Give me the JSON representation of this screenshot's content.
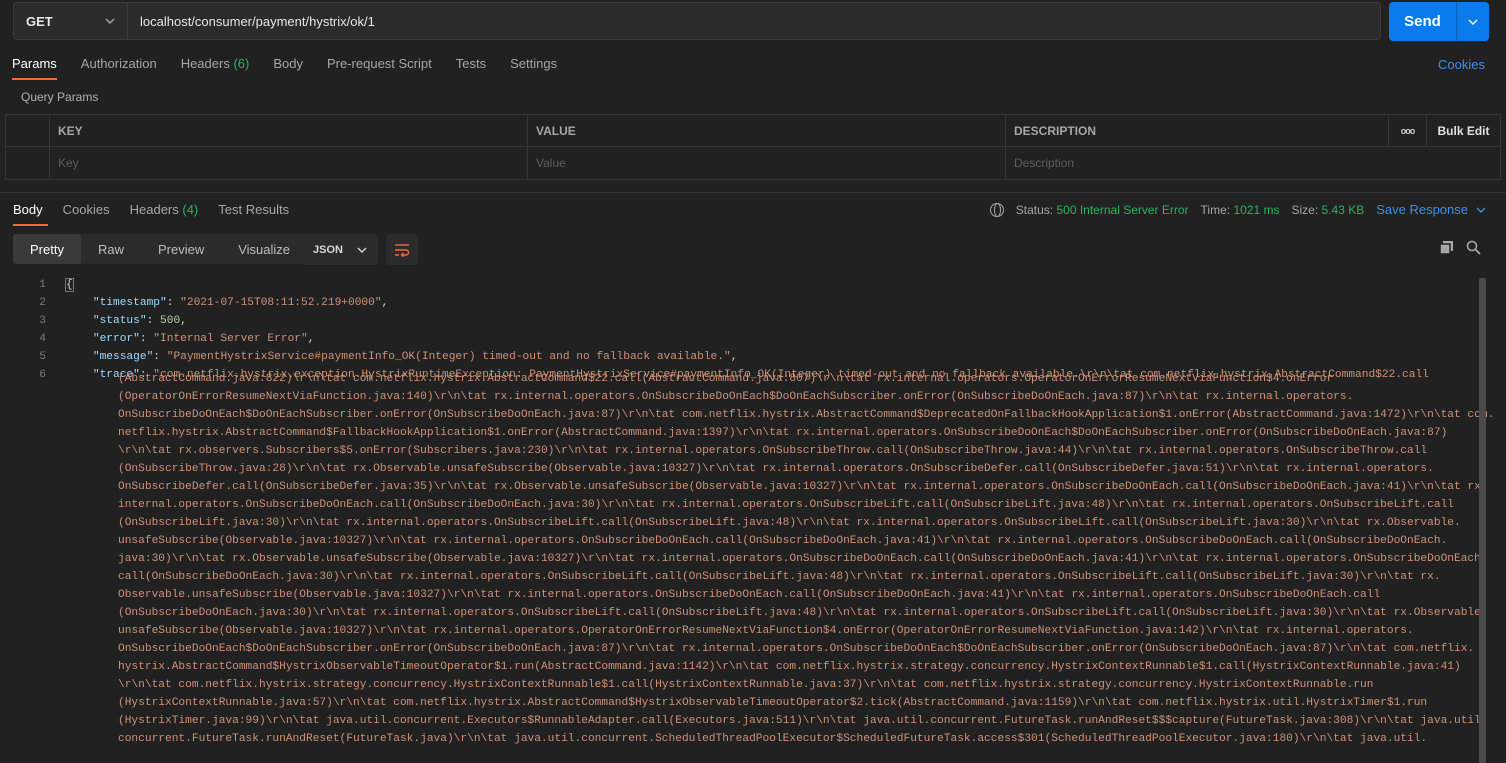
{
  "request": {
    "method": "GET",
    "url": "localhost/consumer/payment/hystrix/ok/1",
    "send_label": "Send"
  },
  "req_tabs": [
    {
      "label": "Params",
      "active": true
    },
    {
      "label": "Authorization"
    },
    {
      "label": "Headers",
      "count": "(6)"
    },
    {
      "label": "Body"
    },
    {
      "label": "Pre-request Script"
    },
    {
      "label": "Tests"
    },
    {
      "label": "Settings"
    }
  ],
  "cookies_label": "Cookies",
  "query_params_label": "Query Params",
  "params_table": {
    "headers": [
      "KEY",
      "VALUE",
      "DESCRIPTION"
    ],
    "more_label": "ooo",
    "bulk_edit_label": "Bulk Edit",
    "placeholders": [
      "Key",
      "Value",
      "Description"
    ]
  },
  "resp_tabs": [
    {
      "label": "Body",
      "active": true
    },
    {
      "label": "Cookies"
    },
    {
      "label": "Headers",
      "count": "(4)"
    },
    {
      "label": "Test Results"
    }
  ],
  "status": {
    "status_label": "Status:",
    "status_value": "500 Internal Server Error",
    "time_label": "Time:",
    "time_value": "1021 ms",
    "size_label": "Size:",
    "size_value": "5.43 KB",
    "save_label": "Save Response"
  },
  "view_modes": [
    {
      "label": "Pretty",
      "active": true
    },
    {
      "label": "Raw"
    },
    {
      "label": "Preview"
    },
    {
      "label": "Visualize"
    }
  ],
  "format": "JSON",
  "code": {
    "line_numbers": [
      "1",
      "2",
      "3",
      "4",
      "5",
      "6"
    ],
    "open_brace": "{",
    "timestamp_key": "\"timestamp\"",
    "timestamp_val": "\"2021-07-15T08:11:52.219+0000\"",
    "status_key": "\"status\"",
    "status_val": "500",
    "error_key": "\"error\"",
    "error_val": "\"Internal Server Error\"",
    "message_key": "\"message\"",
    "message_val": "\"PaymentHystrixService#paymentInfo_OK(Integer) timed-out and no fallback available.\"",
    "trace_key": "\"trace\"",
    "trace_first": "\"com.netflix.hystrix.exception.HystrixRuntimeException: PaymentHystrixService#paymentInfo_OK(Integer) timed-out and no fallback available.\\r\\n\\tat com.netflix.hystrix.AbstractCommand$22.call",
    "trace_lines": [
      "(AbstractCommand.java:822)\\r\\n\\tat com.netflix.hystrix.AbstractCommand$22.call(AbstractCommand.java:807)\\r\\n\\tat rx.internal.operators.OperatorOnErrorResumeNextViaFunction$4.onError",
      "(OperatorOnErrorResumeNextViaFunction.java:140)\\r\\n\\tat rx.internal.operators.OnSubscribeDoOnEach$DoOnEachSubscriber.onError(OnSubscribeDoOnEach.java:87)\\r\\n\\tat rx.internal.operators.",
      "OnSubscribeDoOnEach$DoOnEachSubscriber.onError(OnSubscribeDoOnEach.java:87)\\r\\n\\tat com.netflix.hystrix.AbstractCommand$DeprecatedOnFallbackHookApplication$1.onError(AbstractCommand.java:1472)\\r\\n\\tat com.",
      "netflix.hystrix.AbstractCommand$FallbackHookApplication$1.onError(AbstractCommand.java:1397)\\r\\n\\tat rx.internal.operators.OnSubscribeDoOnEach$DoOnEachSubscriber.onError(OnSubscribeDoOnEach.java:87)",
      "\\r\\n\\tat rx.observers.Subscribers$5.onError(Subscribers.java:230)\\r\\n\\tat rx.internal.operators.OnSubscribeThrow.call(OnSubscribeThrow.java:44)\\r\\n\\tat rx.internal.operators.OnSubscribeThrow.call",
      "(OnSubscribeThrow.java:28)\\r\\n\\tat rx.Observable.unsafeSubscribe(Observable.java:10327)\\r\\n\\tat rx.internal.operators.OnSubscribeDefer.call(OnSubscribeDefer.java:51)\\r\\n\\tat rx.internal.operators.",
      "OnSubscribeDefer.call(OnSubscribeDefer.java:35)\\r\\n\\tat rx.Observable.unsafeSubscribe(Observable.java:10327)\\r\\n\\tat rx.internal.operators.OnSubscribeDoOnEach.call(OnSubscribeDoOnEach.java:41)\\r\\n\\tat rx.",
      "internal.operators.OnSubscribeDoOnEach.call(OnSubscribeDoOnEach.java:30)\\r\\n\\tat rx.internal.operators.OnSubscribeLift.call(OnSubscribeLift.java:48)\\r\\n\\tat rx.internal.operators.OnSubscribeLift.call",
      "(OnSubscribeLift.java:30)\\r\\n\\tat rx.internal.operators.OnSubscribeLift.call(OnSubscribeLift.java:48)\\r\\n\\tat rx.internal.operators.OnSubscribeLift.call(OnSubscribeLift.java:30)\\r\\n\\tat rx.Observable.",
      "unsafeSubscribe(Observable.java:10327)\\r\\n\\tat rx.internal.operators.OnSubscribeDoOnEach.call(OnSubscribeDoOnEach.java:41)\\r\\n\\tat rx.internal.operators.OnSubscribeDoOnEach.call(OnSubscribeDoOnEach.",
      "java:30)\\r\\n\\tat rx.Observable.unsafeSubscribe(Observable.java:10327)\\r\\n\\tat rx.internal.operators.OnSubscribeDoOnEach.call(OnSubscribeDoOnEach.java:41)\\r\\n\\tat rx.internal.operators.OnSubscribeDoOnEach.",
      "call(OnSubscribeDoOnEach.java:30)\\r\\n\\tat rx.internal.operators.OnSubscribeLift.call(OnSubscribeLift.java:48)\\r\\n\\tat rx.internal.operators.OnSubscribeLift.call(OnSubscribeLift.java:30)\\r\\n\\tat rx.",
      "Observable.unsafeSubscribe(Observable.java:10327)\\r\\n\\tat rx.internal.operators.OnSubscribeDoOnEach.call(OnSubscribeDoOnEach.java:41)\\r\\n\\tat rx.internal.operators.OnSubscribeDoOnEach.call",
      "(OnSubscribeDoOnEach.java:30)\\r\\n\\tat rx.internal.operators.OnSubscribeLift.call(OnSubscribeLift.java:48)\\r\\n\\tat rx.internal.operators.OnSubscribeLift.call(OnSubscribeLift.java:30)\\r\\n\\tat rx.Observable.",
      "unsafeSubscribe(Observable.java:10327)\\r\\n\\tat rx.internal.operators.OperatorOnErrorResumeNextViaFunction$4.onError(OperatorOnErrorResumeNextViaFunction.java:142)\\r\\n\\tat rx.internal.operators.",
      "OnSubscribeDoOnEach$DoOnEachSubscriber.onError(OnSubscribeDoOnEach.java:87)\\r\\n\\tat rx.internal.operators.OnSubscribeDoOnEach$DoOnEachSubscriber.onError(OnSubscribeDoOnEach.java:87)\\r\\n\\tat com.netflix.",
      "hystrix.AbstractCommand$HystrixObservableTimeoutOperator$1.run(AbstractCommand.java:1142)\\r\\n\\tat com.netflix.hystrix.strategy.concurrency.HystrixContextRunnable$1.call(HystrixContextRunnable.java:41)",
      "\\r\\n\\tat com.netflix.hystrix.strategy.concurrency.HystrixContextRunnable$1.call(HystrixContextRunnable.java:37)\\r\\n\\tat com.netflix.hystrix.strategy.concurrency.HystrixContextRunnable.run",
      "(HystrixContextRunnable.java:57)\\r\\n\\tat com.netflix.hystrix.AbstractCommand$HystrixObservableTimeoutOperator$2.tick(AbstractCommand.java:1159)\\r\\n\\tat com.netflix.hystrix.util.HystrixTimer$1.run",
      "(HystrixTimer.java:99)\\r\\n\\tat java.util.concurrent.Executors$RunnableAdapter.call(Executors.java:511)\\r\\n\\tat java.util.concurrent.FutureTask.runAndReset$$$capture(FutureTask.java:308)\\r\\n\\tat java.util.",
      "concurrent.FutureTask.runAndReset(FutureTask.java)\\r\\n\\tat java.util.concurrent.ScheduledThreadPoolExecutor$ScheduledFutureTask.access$301(ScheduledThreadPoolExecutor.java:180)\\r\\n\\tat java.util."
    ]
  }
}
